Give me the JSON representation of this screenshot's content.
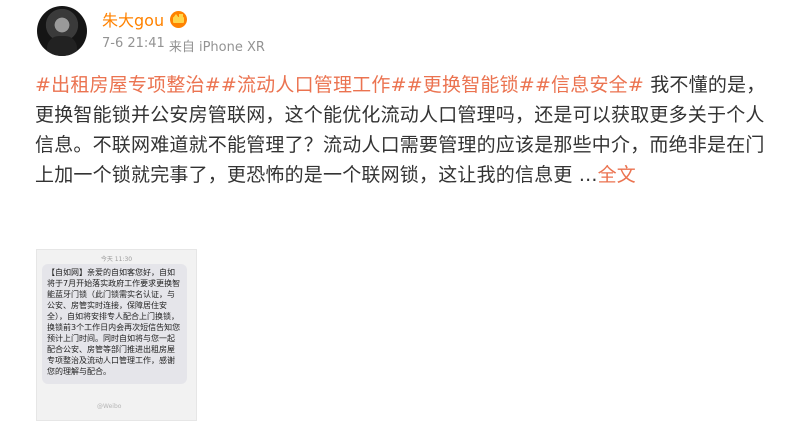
{
  "user": {
    "name": "朱大gou",
    "badge_icon": "crown-badge-icon"
  },
  "meta": {
    "time": "7-6 21:41",
    "source": "来自 iPhone XR"
  },
  "post": {
    "hashtags": [
      "#出租房屋专项整治#",
      "#流动人口管理工作#",
      "#更换智能锁#",
      "#信息安全#"
    ],
    "body": " 我不懂的是，更换智能锁并公安房管联网，这个能优化流动人口管理吗，还是可以获取更多关于个人信息。不联网难道就不能管理了？流动人口需要管理的应该是那些中介，而绝非是在门上加一个锁就完事了，更恐怖的是一个联网锁，这让我的信息更 ...",
    "more_label": "全文"
  },
  "image": {
    "time_label": "今天 11:30",
    "sms_text": "【自如网】亲爱的自如客您好，自如将于7月开始落实政府工作要求更换智能蓝牙门锁（此门锁需实名认证，与公安、房管实时连接，保障居住安全），自如将安排专人配合上门换锁，换锁前3个工作日内会再次短信告知您预计上门时间。同时自如将与您一起配合公安、房管等部门推进出租房屋专项整治及流动人口管理工作，感谢您的理解与配合。",
    "watermark": "@Weibo"
  }
}
